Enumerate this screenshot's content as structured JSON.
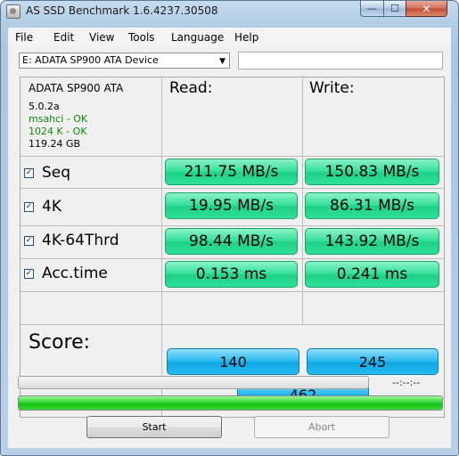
{
  "window": {
    "title": "AS SSD Benchmark 1.6.4237.30508",
    "controls": {
      "minimize": "—",
      "maximize": "☐",
      "close": "✕"
    }
  },
  "menu": [
    "File",
    "Edit",
    "View",
    "Tools",
    "Language",
    "Help"
  ],
  "drive_selector": {
    "value": "E: ADATA SP900 ATA Device",
    "arrow": "▼"
  },
  "drive_info": {
    "model": "ADATA SP900 ATA",
    "firmware": "5.0.2a",
    "driver": "msahci - OK",
    "alignment": "1024 K - OK",
    "capacity": "119.24 GB"
  },
  "headers": {
    "read": "Read:",
    "write": "Write:"
  },
  "check_mark": "✓",
  "tests": [
    {
      "label": "Seq",
      "checked": true,
      "read": "211.75 MB/s",
      "write": "150.83 MB/s"
    },
    {
      "label": "4K",
      "checked": true,
      "read": "19.95 MB/s",
      "write": "86.31 MB/s"
    },
    {
      "label": "4K-64Thrd",
      "checked": true,
      "read": "98.44 MB/s",
      "write": "143.92 MB/s"
    },
    {
      "label": "Acc.time",
      "checked": true,
      "read": "0.153 ms",
      "write": "0.241 ms"
    }
  ],
  "score": {
    "label": "Score:",
    "read": "140",
    "write": "245",
    "total": "462"
  },
  "progress": {
    "timer": "--:--:--",
    "fraction": 0.0
  },
  "status_bar": {
    "fraction": 1.0
  },
  "buttons": {
    "start": "Start",
    "abort": "Abort"
  },
  "colors": {
    "result_green": "#2ee196",
    "score_blue": "#27b9ee",
    "progress_green": "#10c210"
  }
}
